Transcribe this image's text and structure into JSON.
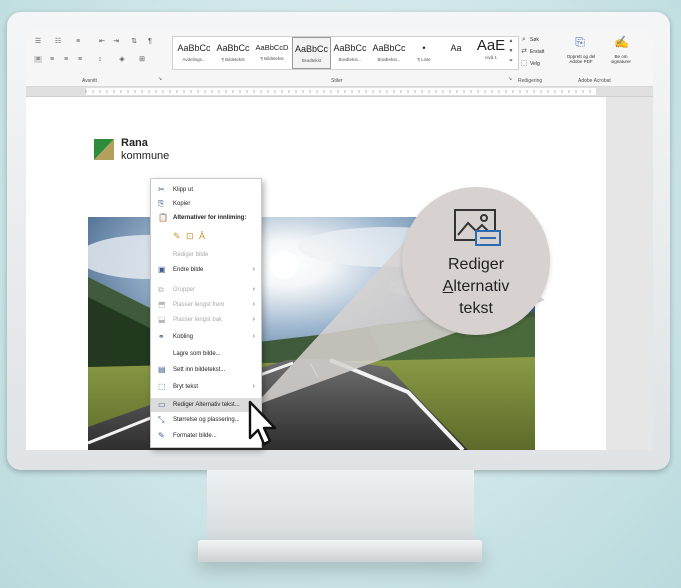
{
  "ribbon": {
    "groups": [
      "Avsnitt",
      "Stiler",
      "Redigering",
      "Adobe Acrobat"
    ],
    "styles": [
      {
        "sample": "AaBbCc",
        "name": "Avdelings..."
      },
      {
        "sample": "AaBbCc",
        "name": "¶ Bildetekst"
      },
      {
        "sample": "AaBbCcD",
        "name": "¶ Bildetekst"
      },
      {
        "sample": "AaBbCc",
        "name": "Brødtekst"
      },
      {
        "sample": "AaBbCc",
        "name": "Brødtekst..."
      },
      {
        "sample": "AaBbCc",
        "name": "Brødtekst..."
      },
      {
        "sample": "•",
        "name": "¶ Liste"
      },
      {
        "sample": "Aa",
        "name": ""
      },
      {
        "sample": "AaE",
        "name": "nivå 1"
      }
    ],
    "editing": {
      "find": "Søk",
      "replace": "Erstatt",
      "select": "Velg"
    },
    "acrobat": {
      "create": "Opprett og del Adobe PDF",
      "request": "Be om signaturer"
    }
  },
  "document": {
    "logo_line1": "Rana",
    "logo_line2": "kommune"
  },
  "context_menu": {
    "items": [
      {
        "label": "Klipp ut",
        "icon": "scissors-icon"
      },
      {
        "label": "Kopier",
        "icon": "copy-icon"
      },
      {
        "label": "Alternativer for innliming:",
        "icon": "paste-icon"
      },
      {
        "label": "Rediger bilde",
        "icon": ""
      },
      {
        "label": "Endre bilde",
        "icon": "change-picture-icon",
        "submenu": true
      },
      {
        "label": "Grupper",
        "icon": "group-icon",
        "submenu": true
      },
      {
        "label": "Plasser lengst frem",
        "icon": "bring-forward-icon",
        "submenu": true
      },
      {
        "label": "Plasser lengst bak",
        "icon": "send-backward-icon",
        "submenu": true
      },
      {
        "label": "Kobling",
        "icon": "link-icon",
        "submenu": true
      },
      {
        "label": "Lagre som bilde...",
        "icon": ""
      },
      {
        "label": "Sett inn bildetekst...",
        "icon": "caption-icon"
      },
      {
        "label": "Bryt tekst",
        "icon": "wrap-text-icon",
        "submenu": true
      },
      {
        "label": "Rediger Alternativ tekst...",
        "icon": "alt-text-icon"
      },
      {
        "label": "Størrelse og plassering...",
        "icon": "size-icon"
      },
      {
        "label": "Formater bilde...",
        "icon": "format-picture-icon"
      }
    ],
    "submenu_arrow": "›",
    "disabled": [
      3,
      5,
      6,
      7
    ],
    "highlighted": 12,
    "bold": [
      2
    ]
  },
  "callout": {
    "line1": "Rediger",
    "line2_underlined": "A",
    "line2_rest": "lternativ",
    "line3": "tekst"
  },
  "colors": {
    "background": "#cfe6e8",
    "callout": "#d7d2d0",
    "logo_green": "#2e8b3a",
    "logo_gold": "#b3a05c"
  }
}
